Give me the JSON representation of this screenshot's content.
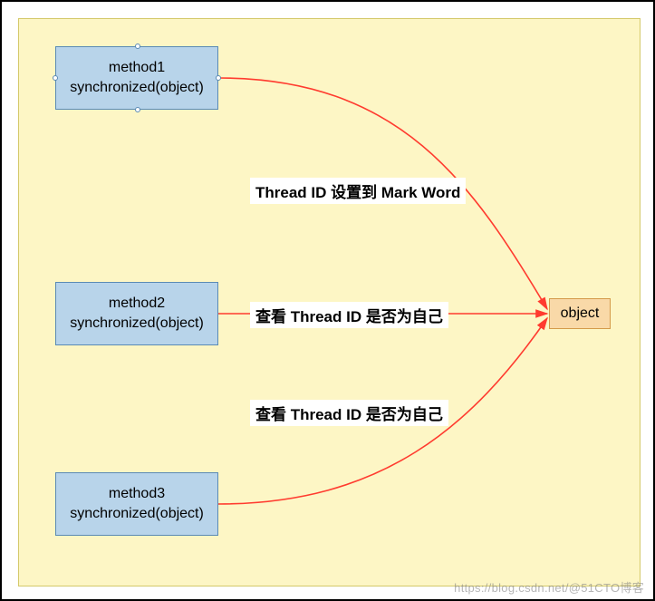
{
  "nodes": {
    "method1": {
      "title": "method1",
      "sub": "synchronized(object)"
    },
    "method2": {
      "title": "method2",
      "sub": "synchronized(object)"
    },
    "method3": {
      "title": "method3",
      "sub": "synchronized(object)"
    },
    "object": {
      "label": "object"
    }
  },
  "labels": {
    "edge1": "Thread ID 设置到 Mark Word",
    "edge2": "查看 Thread ID 是否为自己",
    "edge3": "查看 Thread ID 是否为自己"
  },
  "edges": [
    {
      "from": "method1",
      "to": "object",
      "label_ref": "edge1"
    },
    {
      "from": "method2",
      "to": "object",
      "label_ref": "edge2"
    },
    {
      "from": "method3",
      "to": "object",
      "label_ref": "edge3"
    }
  ],
  "watermark": "https://blog.csdn.net/@51CTO博客"
}
